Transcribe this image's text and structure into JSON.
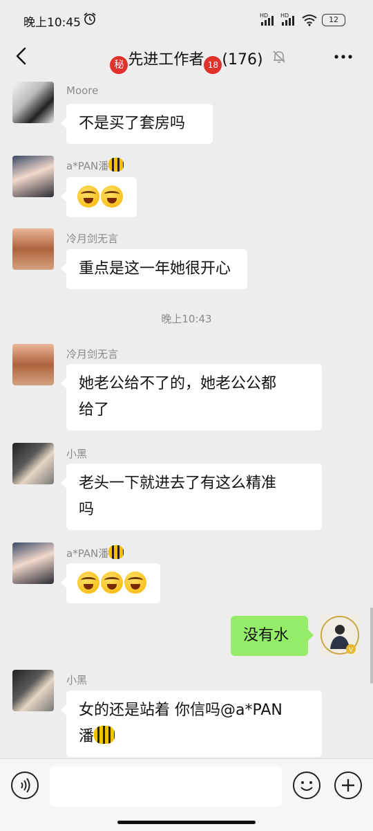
{
  "status_bar": {
    "time": "晚上10:45",
    "network_1": "HD",
    "network_2": "HD",
    "battery": "12"
  },
  "header": {
    "title": "先进工作者",
    "badge_left": "秘",
    "badge_right": "18",
    "member_count": "(176)"
  },
  "messages": [
    {
      "sender": "Moore",
      "text": "不是买了套房吗"
    },
    {
      "sender": "a*PAN潘",
      "emoji_count": 2
    },
    {
      "sender": "冷月剑无言",
      "text": "重点是这一年她很开心"
    },
    {
      "timestamp": "晚上10:43"
    },
    {
      "sender": "冷月剑无言",
      "line1": "她老公给不了的，她老公公都",
      "line2": "给了"
    },
    {
      "sender": "小黑",
      "line1": "老头一下就进去了有这么精准",
      "line2": "吗"
    },
    {
      "sender": "a*PAN潘",
      "emoji_count": 3
    },
    {
      "mine": true,
      "text": "没有水"
    },
    {
      "sender": "小黑",
      "line1": "女的还是站着 你信吗@a*PAN",
      "line2": "潘"
    }
  ],
  "icons": {
    "back": "chevron-left-icon",
    "mute": "bell-off-icon",
    "more": "more-dots-icon",
    "voice": "voice-icon",
    "emoji": "smiley-icon",
    "plus": "plus-icon"
  },
  "colors": {
    "background": "#ededed",
    "bubble_other": "#ffffff",
    "bubble_mine": "#95ec69",
    "badge": "#e0312a"
  }
}
